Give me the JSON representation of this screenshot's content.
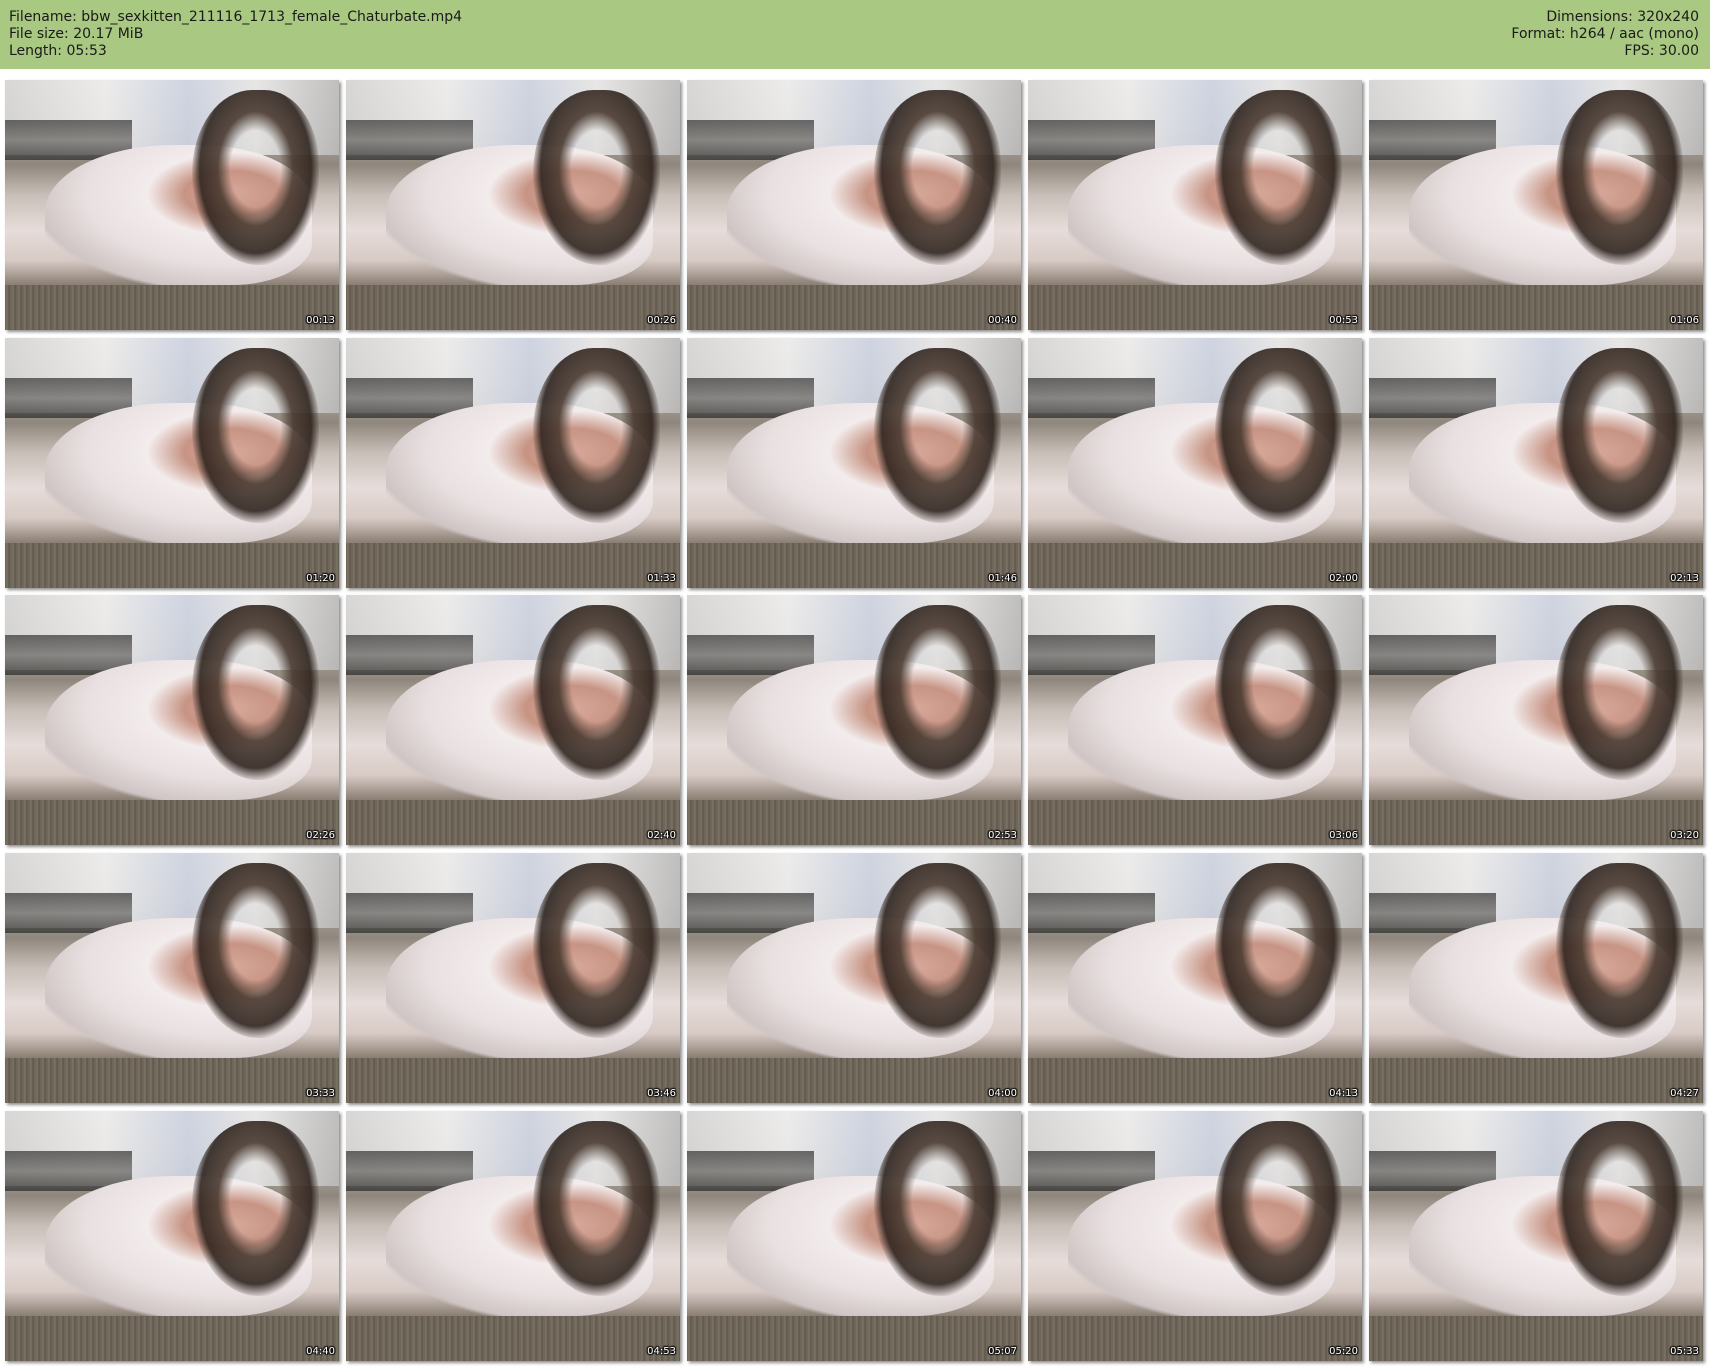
{
  "header": {
    "filename": "Filename: bbw_sexkitten_211116_1713_female_Chaturbate.mp4",
    "file_size": "File size: 20.17 MiB",
    "length": "Length: 05:53",
    "dimensions": "Dimensions: 320x240",
    "format": "Format: h264 / aac (mono)",
    "fps": "FPS: 30.00",
    "background_color": "#a9c882"
  },
  "thumbnails": [
    {
      "timestamp": "00:13"
    },
    {
      "timestamp": "00:26"
    },
    {
      "timestamp": "00:40"
    },
    {
      "timestamp": "00:53"
    },
    {
      "timestamp": "01:06"
    },
    {
      "timestamp": "01:20"
    },
    {
      "timestamp": "01:33"
    },
    {
      "timestamp": "01:46"
    },
    {
      "timestamp": "02:00"
    },
    {
      "timestamp": "02:13"
    },
    {
      "timestamp": "02:26"
    },
    {
      "timestamp": "02:40"
    },
    {
      "timestamp": "02:53"
    },
    {
      "timestamp": "03:06"
    },
    {
      "timestamp": "03:20"
    },
    {
      "timestamp": "03:33"
    },
    {
      "timestamp": "03:46"
    },
    {
      "timestamp": "04:00"
    },
    {
      "timestamp": "04:13"
    },
    {
      "timestamp": "04:27"
    },
    {
      "timestamp": "04:40"
    },
    {
      "timestamp": "04:53"
    },
    {
      "timestamp": "05:07"
    },
    {
      "timestamp": "05:20"
    },
    {
      "timestamp": "05:33"
    }
  ]
}
